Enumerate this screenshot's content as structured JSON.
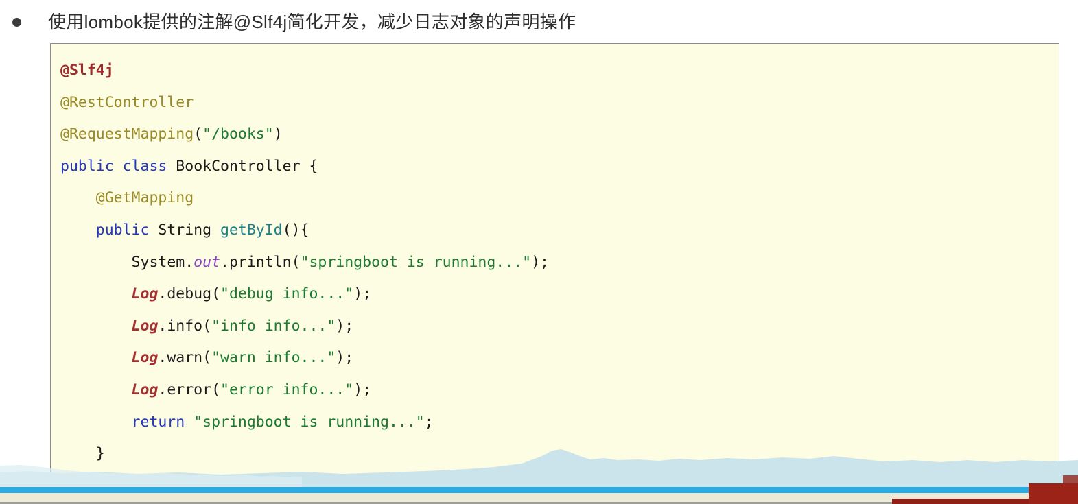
{
  "slide": {
    "bullet": {
      "marker": "bullet-dot",
      "text": "使用lombok提供的注解@Slf4j简化开发，减少日志对象的声明操作"
    }
  },
  "code_block": {
    "language": "java",
    "background_color": "#fdfde4",
    "border_color": "#8a8a8a",
    "lines": [
      [
        {
          "text": "@Slf4j",
          "cls": "t-anno-hl"
        }
      ],
      [
        {
          "text": "@RestController",
          "cls": "t-anno"
        }
      ],
      [
        {
          "text": "@RequestMapping",
          "cls": "t-anno"
        },
        {
          "text": "(",
          "cls": "t-plain"
        },
        {
          "text": "\"/books\"",
          "cls": "t-str"
        },
        {
          "text": ")",
          "cls": "t-plain"
        }
      ],
      [
        {
          "text": "public",
          "cls": "t-kw"
        },
        {
          "text": " ",
          "cls": "t-plain"
        },
        {
          "text": "class",
          "cls": "t-kw"
        },
        {
          "text": " BookController {",
          "cls": "t-plain"
        }
      ],
      [
        {
          "text": "    ",
          "cls": "t-plain"
        },
        {
          "text": "@GetMapping",
          "cls": "t-anno"
        }
      ],
      [
        {
          "text": "    ",
          "cls": "t-plain"
        },
        {
          "text": "public",
          "cls": "t-kw"
        },
        {
          "text": " String ",
          "cls": "t-plain"
        },
        {
          "text": "getById",
          "cls": "t-method"
        },
        {
          "text": "(){",
          "cls": "t-plain"
        }
      ],
      [
        {
          "text": "        System.",
          "cls": "t-plain"
        },
        {
          "text": "out",
          "cls": "t-field"
        },
        {
          "text": ".println(",
          "cls": "t-plain"
        },
        {
          "text": "\"springboot is running...\"",
          "cls": "t-str"
        },
        {
          "text": ");",
          "cls": "t-plain"
        }
      ],
      [
        {
          "text": "        ",
          "cls": "t-plain"
        },
        {
          "text": "Log",
          "cls": "t-logref"
        },
        {
          "text": ".debug(",
          "cls": "t-plain"
        },
        {
          "text": "\"debug info...\"",
          "cls": "t-str"
        },
        {
          "text": ");",
          "cls": "t-plain"
        }
      ],
      [
        {
          "text": "        ",
          "cls": "t-plain"
        },
        {
          "text": "Log",
          "cls": "t-logref"
        },
        {
          "text": ".info(",
          "cls": "t-plain"
        },
        {
          "text": "\"info info...\"",
          "cls": "t-str"
        },
        {
          "text": ");",
          "cls": "t-plain"
        }
      ],
      [
        {
          "text": "        ",
          "cls": "t-plain"
        },
        {
          "text": "Log",
          "cls": "t-logref"
        },
        {
          "text": ".warn(",
          "cls": "t-plain"
        },
        {
          "text": "\"warn info...\"",
          "cls": "t-str"
        },
        {
          "text": ");",
          "cls": "t-plain"
        }
      ],
      [
        {
          "text": "        ",
          "cls": "t-plain"
        },
        {
          "text": "Log",
          "cls": "t-logref"
        },
        {
          "text": ".error(",
          "cls": "t-plain"
        },
        {
          "text": "\"error info...\"",
          "cls": "t-str"
        },
        {
          "text": ");",
          "cls": "t-plain"
        }
      ],
      [
        {
          "text": "        ",
          "cls": "t-plain"
        },
        {
          "text": "return",
          "cls": "t-kw"
        },
        {
          "text": " ",
          "cls": "t-plain"
        },
        {
          "text": "\"springboot is running...\"",
          "cls": "t-str"
        },
        {
          "text": ";",
          "cls": "t-plain"
        }
      ],
      [
        {
          "text": "    }",
          "cls": "t-plain"
        }
      ],
      [
        {
          "text": "}",
          "cls": "t-plain"
        }
      ]
    ]
  },
  "decoration": {
    "wave_color": "#cbe4ec",
    "wave_color_light": "#dceef3",
    "blue_bar_color": "#29abe2",
    "beige_strip_color": "#ecead7",
    "red_corner_color": "#9b2318"
  }
}
